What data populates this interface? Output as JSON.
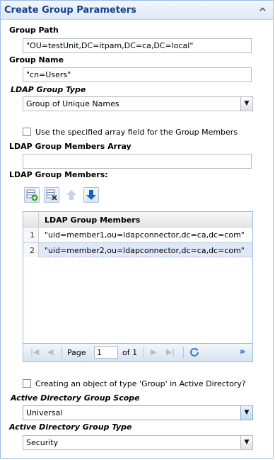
{
  "panel": {
    "title": "Create Group Parameters"
  },
  "group_path": {
    "label": "Group Path",
    "value": "\"OU=testUnit,DC=itpam,DC=ca,DC=local\""
  },
  "group_name": {
    "label": "Group Name",
    "value": "\"cn=Users\""
  },
  "ldap_group_type": {
    "label": "LDAP Group Type",
    "value": "Group of Unique Names"
  },
  "use_array_field": {
    "label": "Use the specified array field for the Group Members",
    "checked": false
  },
  "members_array": {
    "label": "LDAP Group Members Array",
    "value": ""
  },
  "members": {
    "label": "LDAP Group Members:",
    "toolbar": [
      {
        "name": "add-row-button",
        "icon": "add-row-icon",
        "enabled": true
      },
      {
        "name": "delete-row-button",
        "icon": "delete-row-icon",
        "enabled": true
      },
      {
        "name": "move-up-button",
        "icon": "arrow-up-icon",
        "enabled": false
      },
      {
        "name": "move-down-button",
        "icon": "arrow-down-icon",
        "enabled": true
      }
    ],
    "grid": {
      "column": "LDAP Group Members",
      "rows": [
        {
          "num": "1",
          "value": "\"uid=member1,ou=ldapconnector,dc=ca,dc=com\""
        },
        {
          "num": "2",
          "value": "\"uid=member2,ou=ldapconnector,dc=ca,dc=com\""
        }
      ],
      "pager": {
        "page_label": "Page",
        "page_value": "1",
        "of_label": "of 1"
      }
    }
  },
  "ad_object": {
    "label": "Creating an object of type 'Group' in Active Directory?",
    "checked": false
  },
  "ad_scope": {
    "label": "Active Directory Group Scope",
    "value": "Universal"
  },
  "ad_type": {
    "label": "Active Directory Group Type",
    "value": "Security"
  },
  "colors": {
    "header_text": "#15428b",
    "border": "#99bbe8",
    "selected_row": "#dfe8f6",
    "accent_blue": "#1565c0"
  }
}
